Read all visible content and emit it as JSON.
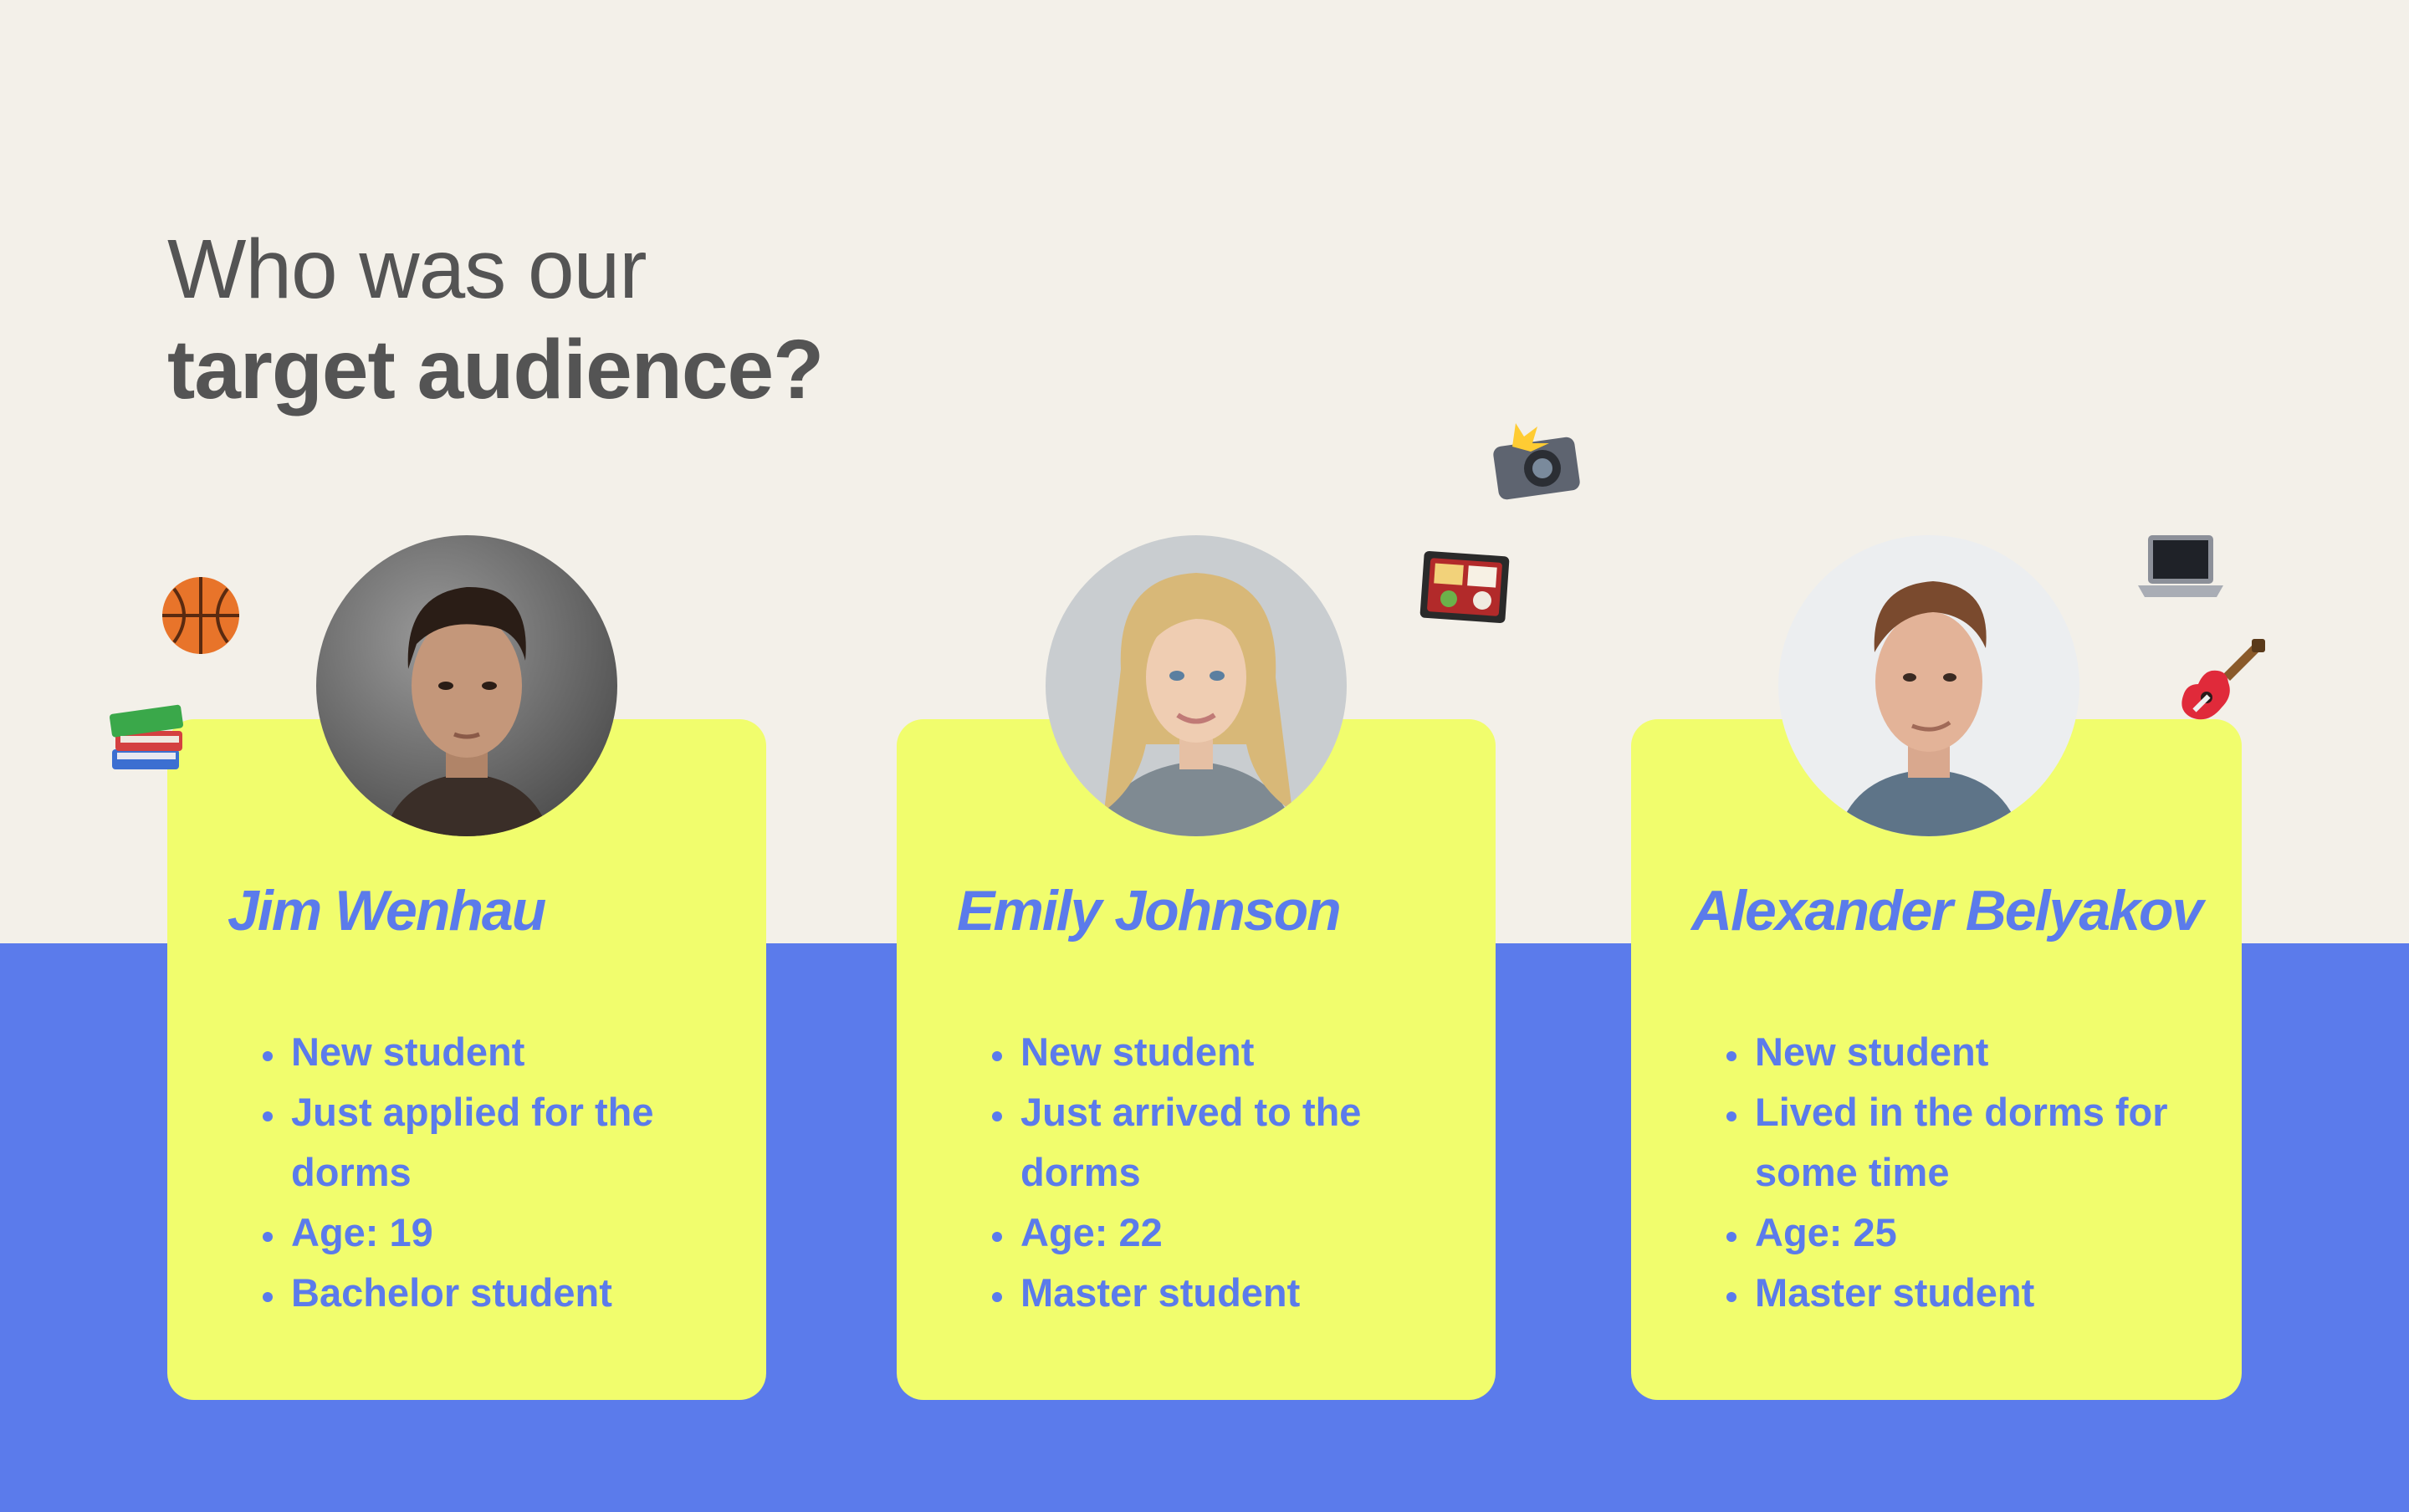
{
  "heading": {
    "line1": "Who was our",
    "line2": "target audience?"
  },
  "personas": [
    {
      "name": "Jim Wenhau",
      "traits": [
        "New student",
        "Just applied for the dorms",
        "Age: 19",
        "Bachelor student"
      ]
    },
    {
      "name": "Emily Johnson",
      "traits": [
        "New student",
        "Just arrived to the dorms",
        "Age: 22",
        "Master student"
      ]
    },
    {
      "name": "Alexander Belyakov",
      "traits": [
        "New student",
        "Lived in the dorms for some time",
        "Age: 25",
        "Master student"
      ]
    }
  ],
  "decorations": [
    "basketball-icon",
    "books-icon",
    "bento-box-icon",
    "camera-flash-icon",
    "laptop-icon",
    "guitar-icon"
  ],
  "colors": {
    "background": "#f3f0e9",
    "band": "#5b7beb",
    "card": "#f1fd6d",
    "accent_text": "#5b7beb",
    "heading_text": "#545454"
  }
}
